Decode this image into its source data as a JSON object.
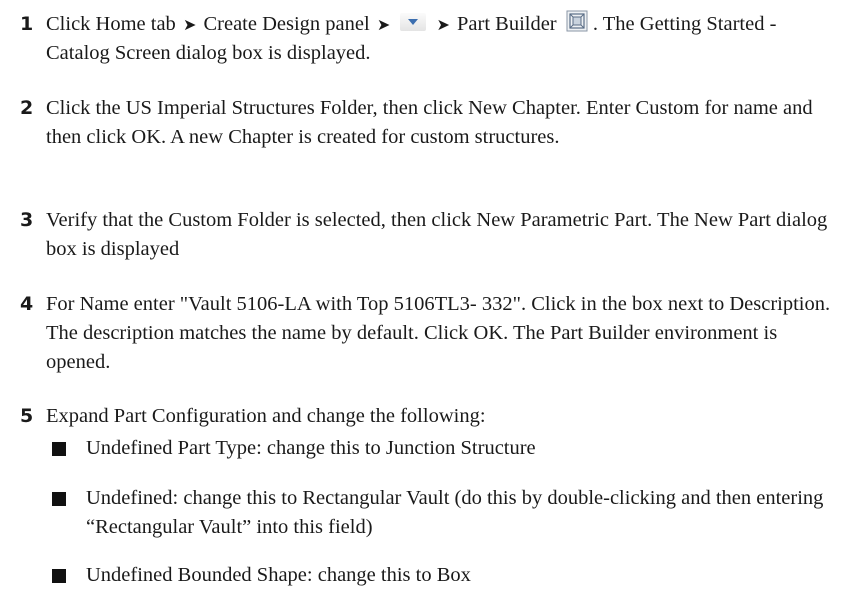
{
  "steps": [
    {
      "number": "1",
      "part_a": "Click Home tab",
      "part_b": "Create Design panel",
      "part_c": "Part Builder",
      "part_d": ". The Getting Started - Catalog Screen dialog box is displayed."
    },
    {
      "number": "2",
      "text": "Click the US Imperial Structures Folder, then click New Chapter. Enter Custom for name and then click OK. A new Chapter is created for custom structures."
    },
    {
      "number": "3",
      "text": "Verify that the Custom Folder is selected, then click New Parametric Part. The New Part dialog box is displayed"
    },
    {
      "number": "4",
      "text": "For Name enter \"Vault 5106-LA with Top 5106TL3- 332\". Click in the box next to Description. The description matches the name by default. Click OK. The Part Builder environment is opened."
    },
    {
      "number": "5",
      "text": "Expand Part Configuration and change the following:"
    }
  ],
  "bullets": [
    "Undefined Part Type: change this to Junction Structure",
    "Undefined: change this to Rectangular Vault (do this by double-clicking and then entering “Rectangular Vault” into this field)",
    "Undefined Bounded Shape: change this to Box"
  ],
  "icons": {
    "arrow": "right-arrowhead-icon",
    "dropdown": "dropdown-arrow-icon",
    "part_builder": "part-builder-icon"
  }
}
